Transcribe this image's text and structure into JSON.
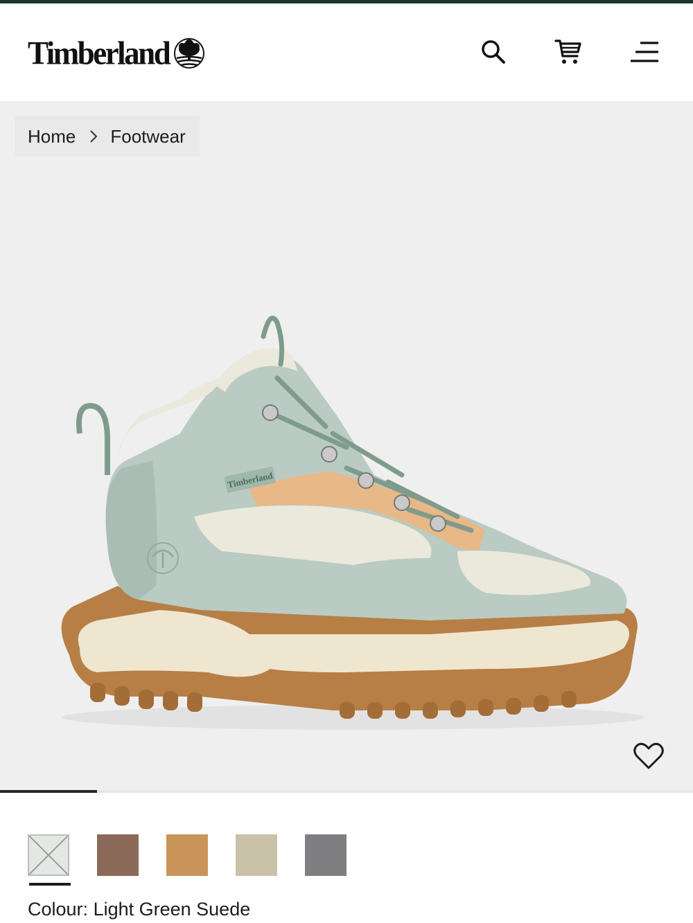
{
  "header": {
    "logo_text": "Timberland",
    "icons": [
      "search-icon",
      "cart-icon",
      "menu-icon"
    ]
  },
  "breadcrumb": {
    "items": [
      "Home",
      "Footwear"
    ]
  },
  "product": {
    "image_icon": "hiking-boot-image",
    "boot_tag": "Timberland",
    "wishlist_icon": "heart-icon",
    "gallery_progress": 0.14
  },
  "colours": {
    "label": "Colour:",
    "selected_name": "Light Green Suede",
    "swatches": [
      {
        "name": "light-green-suede",
        "color": "#e4e8e4"
      },
      {
        "name": "brown",
        "color": "#8c6a5a"
      },
      {
        "name": "wheat",
        "color": "#c9955a"
      },
      {
        "name": "beige",
        "color": "#c9c2a8"
      },
      {
        "name": "grey",
        "color": "#7f7f81"
      }
    ]
  },
  "colors": {
    "top_bar": "#1b3a2c",
    "hero_bg": "#efefef",
    "text": "#1c1c1c"
  }
}
